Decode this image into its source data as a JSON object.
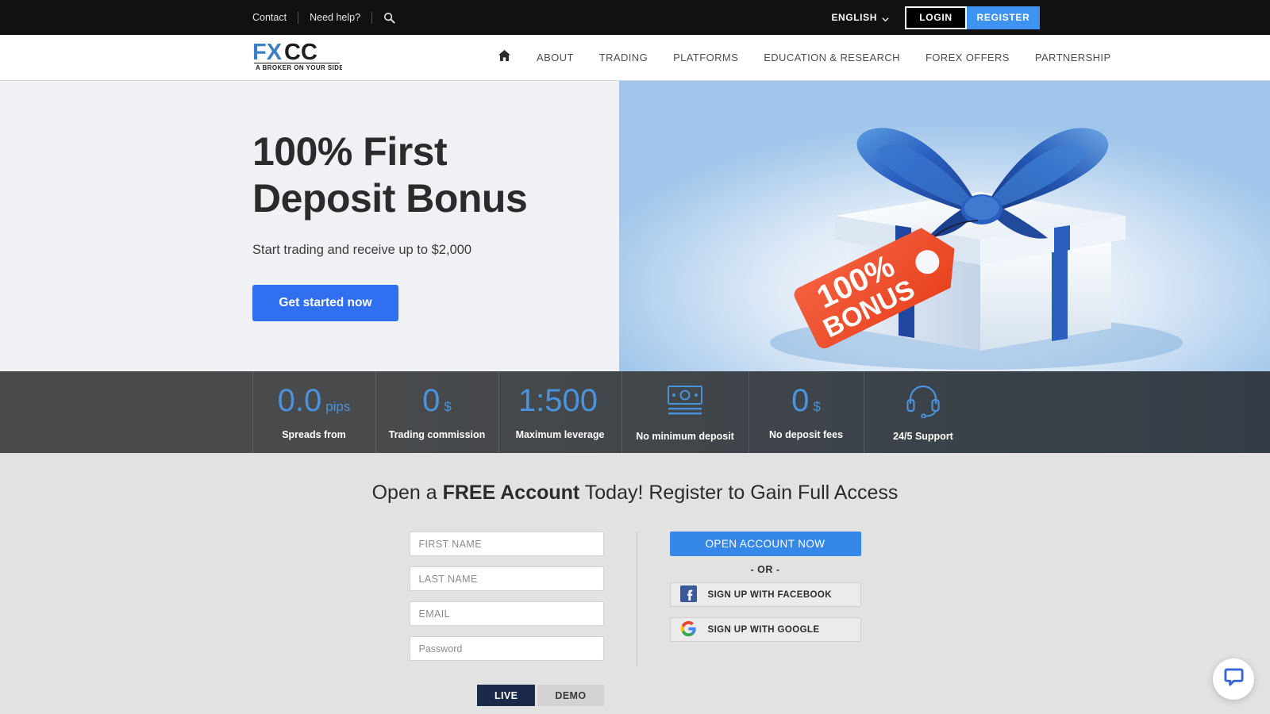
{
  "topbar": {
    "contact_label": "Contact",
    "help_label": "Need help?",
    "search_icon": "search-icon",
    "language": "ENGLISH",
    "login_label": "LOGIN",
    "register_label": "REGISTER"
  },
  "brand": {
    "name_fx": "FX",
    "name_cc": "CC",
    "tagline": "A BROKER ON YOUR SIDE",
    "blue": "#3d7fc4",
    "black": "#1d1d1d"
  },
  "nav": {
    "home_icon": "home-icon",
    "items": [
      {
        "label": "ABOUT"
      },
      {
        "label": "TRADING"
      },
      {
        "label": "PLATFORMS"
      },
      {
        "label": "EDUCATION & RESEARCH"
      },
      {
        "label": "FOREX OFFERS"
      },
      {
        "label": "PARTNERSHIP"
      }
    ]
  },
  "hero": {
    "title_line1": "100% First",
    "title_line2": "Deposit Bonus",
    "subtitle": "Start trading and receive up to $2,000",
    "cta_label": "Get started now",
    "cta_color": "#2f6ff0",
    "background": "#eff1f5",
    "art": {
      "name": "gift-box-illustration",
      "tag_line1": "100%",
      "tag_line2": "BONUS",
      "tag_color": "#f04e32",
      "ribbon_color": "#2a5fc0"
    }
  },
  "stats": {
    "accent": "#4a92d9",
    "items": [
      {
        "value": "0.0",
        "unit": "pips",
        "label": "Spreads from",
        "icon": null
      },
      {
        "value": "0",
        "unit": "$",
        "label": "Trading commission",
        "icon": null
      },
      {
        "value": "1:500",
        "unit": "",
        "label": "Maximum leverage",
        "icon": null
      },
      {
        "value": "",
        "unit": "",
        "label": "No minimum deposit",
        "icon": "banknote-icon"
      },
      {
        "value": "0",
        "unit": "$",
        "label": "No deposit fees",
        "icon": null
      },
      {
        "value": "",
        "unit": "",
        "label": "24/5 Support",
        "icon": "headset-icon"
      }
    ]
  },
  "signup": {
    "heading_pre": "Open a ",
    "heading_bold": "FREE Account",
    "heading_post": " Today! Register to Gain Full Access",
    "fields": [
      {
        "name": "first-name-field",
        "placeholder": "FIRST NAME",
        "value": ""
      },
      {
        "name": "last-name-field",
        "placeholder": "LAST NAME",
        "value": ""
      },
      {
        "name": "email-field",
        "placeholder": "EMAIL",
        "value": ""
      },
      {
        "name": "password-field",
        "placeholder": "Password",
        "value": ""
      }
    ],
    "tab_live": "LIVE",
    "tab_demo": "DEMO",
    "open_account_label": "OPEN ACCOUNT NOW",
    "or_label": "- OR -",
    "facebook_label": "SIGN UP WITH FACEBOOK",
    "google_label": "SIGN UP WITH GOOGLE",
    "open_account_color": "#3688e8"
  },
  "chat": {
    "icon": "chat-bubble-icon",
    "color": "#3a63d8"
  }
}
